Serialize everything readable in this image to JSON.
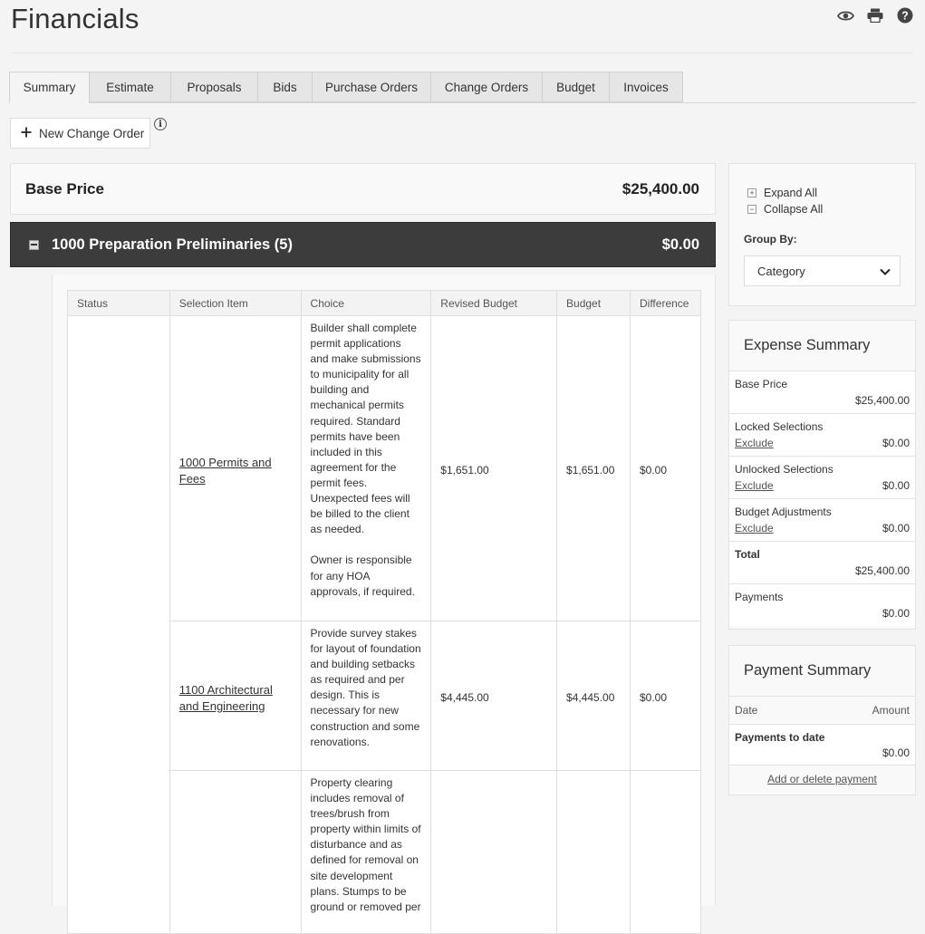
{
  "page": {
    "title": "Financials"
  },
  "icons": {
    "view": "eye-icon",
    "print": "printer-icon",
    "help": "help-icon"
  },
  "tabs": [
    {
      "label": "Summary",
      "active": true
    },
    {
      "label": "Estimate"
    },
    {
      "label": "Proposals"
    },
    {
      "label": "Bids"
    },
    {
      "label": "Purchase Orders"
    },
    {
      "label": "Change Orders"
    },
    {
      "label": "Budget"
    },
    {
      "label": "Invoices"
    }
  ],
  "actions": {
    "new_change_order": "New Change Order",
    "info_glyph": "i"
  },
  "base_price": {
    "label": "Base Price",
    "value": "$25,400.00"
  },
  "category": {
    "name": "1000 Preparation Preliminaries (5)",
    "total": "$0.00"
  },
  "table": {
    "columns": [
      "Status",
      "Selection Item",
      "Choice",
      "Revised Budget",
      "Budget",
      "Difference"
    ],
    "rows": [
      {
        "status": "",
        "item": "1000 Permits and Fees",
        "choice": "Builder shall complete permit applications and make submissions to municipality for all building and mechanical permits required. Standard permits have been included in this agreement for the permit fees. Unexpected fees will be billed to the client as needed.\n\nOwner is responsible for any HOA approvals, if required.",
        "revised_budget": "$1,651.00",
        "budget": "$1,651.00",
        "difference": "$0.00"
      },
      {
        "status": "",
        "item": "1100 Architectural and Engineering",
        "choice": "Provide survey stakes for layout of foundation and building setbacks as required and per design. This is necessary for new construction and some renovations.",
        "revised_budget": "$4,445.00",
        "budget": "$4,445.00",
        "difference": "$0.00"
      },
      {
        "status": "",
        "item": "",
        "choice": "Property clearing includes removal of trees/brush from property within limits of disturbance and as defined for removal on site development plans. Stumps to be ground or removed per",
        "revised_budget": "",
        "budget": "",
        "difference": ""
      }
    ]
  },
  "sidebar": {
    "expand_all": "Expand All",
    "collapse_all": "Collapse All",
    "group_by_label": "Group By:",
    "group_by_value": "Category"
  },
  "expense_summary": {
    "title": "Expense Summary",
    "exclude_label": "Exclude",
    "items": [
      {
        "label": "Base Price",
        "value": "$25,400.00"
      },
      {
        "label": "Locked Selections",
        "value": "$0.00",
        "excludable": true
      },
      {
        "label": "Unlocked Selections",
        "value": "$0.00",
        "excludable": true
      },
      {
        "label": "Budget Adjustments",
        "value": "$0.00",
        "excludable": true
      },
      {
        "label": "Total",
        "value": "$25,400.00",
        "bold": true
      },
      {
        "label": "Payments",
        "value": "$0.00"
      }
    ]
  },
  "payment_summary": {
    "title": "Payment Summary",
    "col_date": "Date",
    "col_amount": "Amount",
    "to_date_label": "Payments to date",
    "to_date_value": "$0.00",
    "add_link": "Add or delete payment"
  }
}
